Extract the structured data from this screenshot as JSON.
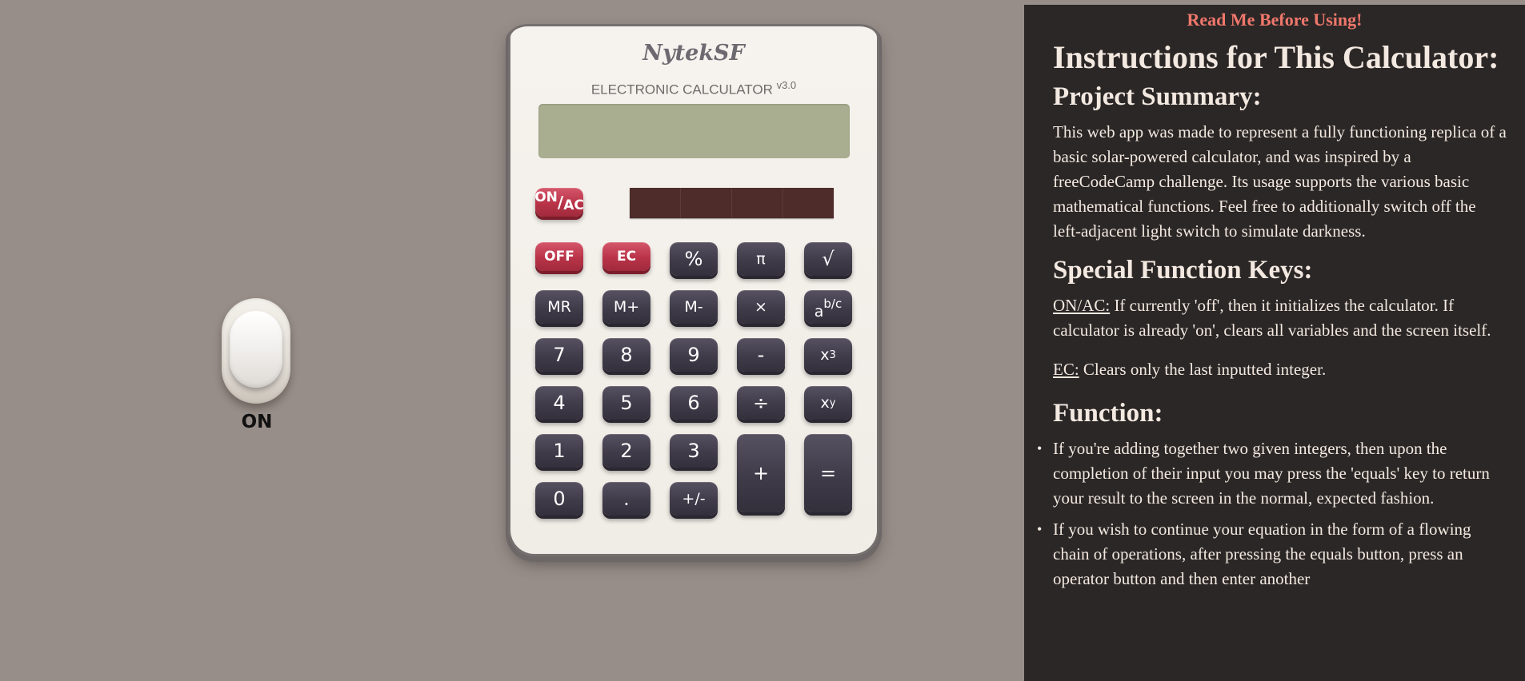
{
  "light_switch": {
    "label": "ON"
  },
  "calculator": {
    "brand": "NytekSF",
    "model": "ELECTRONIC CALCULATOR",
    "version": "v3.0",
    "display_value": "",
    "keys": {
      "on_ac_top": "ON",
      "on_ac_slash": "/",
      "on_ac_bottom": "AC",
      "off": "OFF",
      "ec": "EC",
      "percent": "%",
      "pi": "π",
      "sqrt": "√",
      "mr": "MR",
      "m_plus": "M+",
      "m_minus": "M-",
      "multiply": "×",
      "fraction_a": "a",
      "fraction_bc": "b/c",
      "seven": "7",
      "eight": "8",
      "nine": "9",
      "minus": "-",
      "x_cubed_base": "x",
      "x_cubed_exp": "3",
      "four": "4",
      "five": "5",
      "six": "6",
      "divide": "÷",
      "x_pow_base": "x",
      "x_pow_exp": "y",
      "one": "1",
      "two": "2",
      "three": "3",
      "plus": "+",
      "equals": "=",
      "zero": "0",
      "decimal": ".",
      "plus_minus": "+/-"
    }
  },
  "instructions": {
    "notice": "Read Me Before Using!",
    "title": "Instructions for This Calculator:",
    "summary_heading": "Project Summary:",
    "summary_text": "This web app was made to represent a fully functioning replica of a basic solar-powered calculator, and was inspired by a freeCodeCamp challenge. Its usage supports the various basic mathematical functions. Feel free to additionally switch off the left-adjacent light switch to simulate darkness.",
    "special_heading": "Special Function Keys:",
    "on_ac_term": "ON/AC:",
    "on_ac_text": " If currently 'off', then it initializes the calculator. If calculator is already 'on', clears all variables and the screen itself.",
    "ec_term": "EC:",
    "ec_text": " Clears only the last inputted integer.",
    "function_heading": "Function:",
    "function_items": [
      "If you're adding together two given integers, then upon the completion of their input you may press the 'equals' key to return your result to the screen in the normal, expected fashion.",
      "If you wish to continue your equation in the form of a flowing chain of operations, after pressing the equals button, press an operator button and then enter another"
    ]
  }
}
